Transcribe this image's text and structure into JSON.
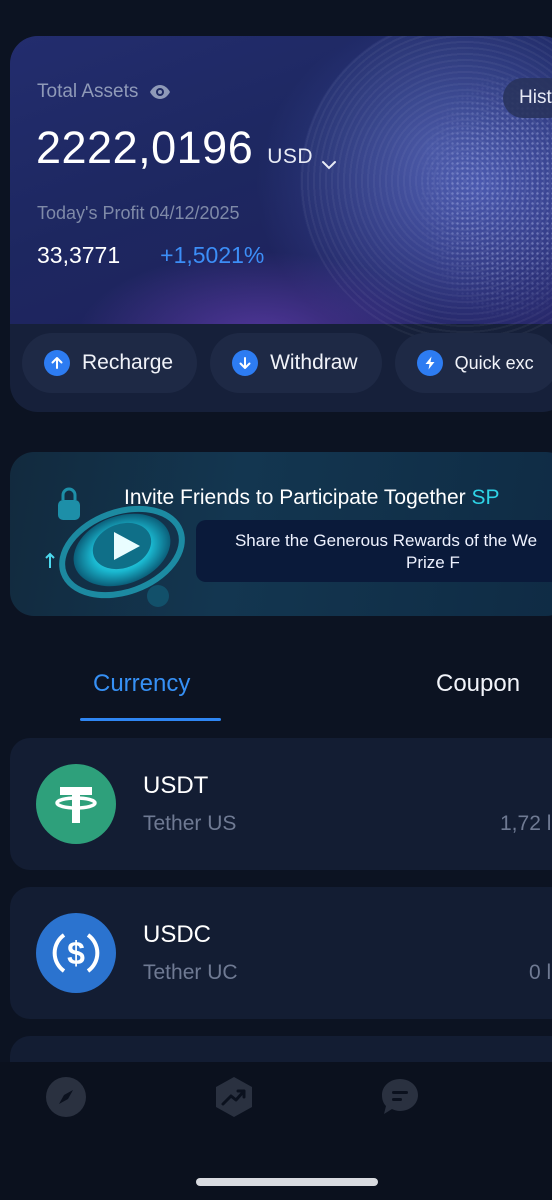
{
  "assets": {
    "total_label": "Total Assets",
    "history_label": "Hist",
    "total_value": "2222,0196",
    "currency": "USD",
    "profit_label": "Today's Profit 04/12/2025",
    "profit_value": "33,3771",
    "profit_percent": "+1,5021%"
  },
  "actions": [
    {
      "label": "Recharge",
      "icon": "arrow-up-icon"
    },
    {
      "label": "Withdraw",
      "icon": "arrow-down-icon"
    },
    {
      "label": "Quick exc",
      "icon": "lightning-icon"
    }
  ],
  "banner": {
    "title": "Invite Friends to Participate Together",
    "title_highlight": "SP",
    "subtitle_line1": "Share the Generous Rewards of the We",
    "subtitle_line2": "Prize F"
  },
  "tabs": {
    "currency": "Currency",
    "coupon": "Coupon"
  },
  "coins": [
    {
      "symbol": "USDT",
      "name": "Tether US",
      "amount": "1",
      "value": "1,72 l",
      "icon": "tether-icon"
    },
    {
      "symbol": "USDC",
      "name": "Tether UC",
      "amount": "",
      "value": "0 l",
      "icon": "usdc-icon"
    }
  ],
  "nav": [
    "compass-icon",
    "trend-icon",
    "chat-icon",
    "profile-icon"
  ],
  "colors": {
    "background": "#0c1322",
    "accent": "#2d7cf2",
    "profit": "#3c8ef7",
    "tether": "#2ea07b",
    "usdc": "#2b73cf",
    "highlight": "#2ed3e6"
  }
}
